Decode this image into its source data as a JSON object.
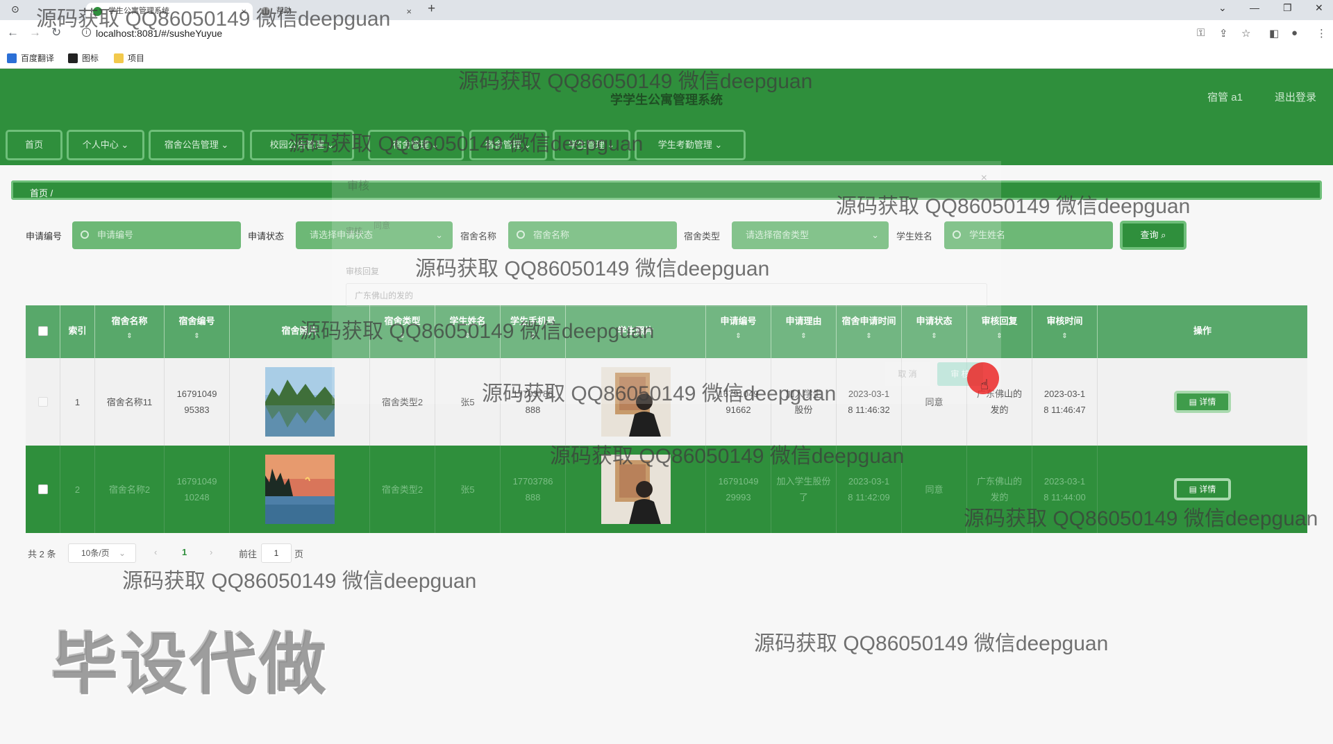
{
  "browser": {
    "tabs": [
      {
        "label": "学生公寓管理系统"
      },
      {
        "label": "帮助"
      }
    ],
    "url": "localhost:8081/#/susheYuyue",
    "bookmarks": [
      {
        "label": "百度翻译"
      },
      {
        "label": "图标"
      },
      {
        "label": "项目"
      }
    ]
  },
  "header": {
    "title": "学学生公寓管理系统",
    "user": "宿管 a1",
    "logout": "退出登录"
  },
  "menu": [
    {
      "label": "首页"
    },
    {
      "label": "个人中心 ⌄"
    },
    {
      "label": "宿舍公告管理 ⌄"
    },
    {
      "label": "校园公告管理 ⌄"
    },
    {
      "label": "宿舍管理 ⌄"
    },
    {
      "label": "宿舍管理 ⌄"
    },
    {
      "label": "学生管理 ⌄"
    },
    {
      "label": "学生考勤管理 ⌄"
    }
  ],
  "breadcrumb": {
    "home": "首页",
    "sep": "/"
  },
  "search": {
    "fields": [
      {
        "label": "申请编号",
        "placeholder": "申请编号"
      },
      {
        "label": "申请状态",
        "placeholder": "请选择申请状态"
      },
      {
        "label": "宿舍名称",
        "placeholder": "宿舍名称"
      },
      {
        "label": "宿舍类型",
        "placeholder": "请选择宿舍类型"
      },
      {
        "label": "学生姓名",
        "placeholder": "学生姓名"
      }
    ],
    "query_button": "查询 ⌕"
  },
  "table": {
    "headers": [
      "",
      "索引",
      "宿舍名称",
      "宿舍编号",
      "宿舍照片",
      "宿舍类型",
      "学生姓名",
      "学生手机号",
      "学生照片",
      "申请编号",
      "申请理由",
      "宿舍申请时间",
      "申请状态",
      "审核回复",
      "审核时间",
      "操作"
    ],
    "rows": [
      {
        "index": "1",
        "name": "宿舍名称11",
        "number": "16791049\n95383",
        "type": "宿舍类型2",
        "student": "张5",
        "phone": "17703786\n888",
        "apply_no": "16791049\n91662",
        "reason": "加入学生\n股份",
        "apply_time": "2023-03-1\n8 11:46:32",
        "status": "同意",
        "reply": "广东佛山的\n发的",
        "review_time": "2023-03-1\n8 11:46:47",
        "action": "详情"
      },
      {
        "index": "2",
        "name": "宿舍名称2",
        "number": "16791049\n10248",
        "type": "宿舍类型2",
        "student": "张5",
        "phone": "17703786\n888",
        "apply_no": "16791049\n29993",
        "reason": "加入学生股份\n了",
        "apply_time": "2023-03-1\n8 11:42:09",
        "status": "同意",
        "reply": "广东佛山的\n发的",
        "review_time": "2023-03-1\n8 11:44:00",
        "action": "详情"
      }
    ]
  },
  "pagination": {
    "total": "共 2 条",
    "page_size": "10条/页",
    "current": "1",
    "goto_prefix": "前往",
    "goto_value": "1",
    "goto_suffix": "页"
  },
  "dialog": {
    "title": "审核",
    "status_label": "审核",
    "status_value": "同意",
    "reply_label": "审核回复",
    "reply_value": "广东佛山的发的",
    "cancel": "取 消",
    "confirm": "审 核"
  },
  "watermarks": {
    "text": "源码获取 QQ86050149 微信deepguan",
    "big": "毕设代做"
  },
  "colors": {
    "primary": "#2f8f3c",
    "header_row": "#58a86a",
    "input_fill": "#6db876"
  }
}
